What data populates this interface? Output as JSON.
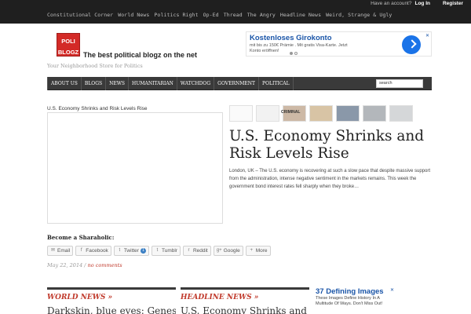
{
  "topbar": {
    "nav": [
      "Constitutional Corner",
      "World News",
      "Politics Right",
      "Op-Ed",
      "Thread",
      "The Angry",
      "Headline News",
      "Weird, Strange & Ugly"
    ],
    "account_prompt": "Have an account?",
    "login": "Log In",
    "register": "Register"
  },
  "header": {
    "logo_line1": "POLI",
    "logo_line2": "BLOGZ",
    "tagline": "The best political blogz on the net",
    "subtagline": "Your Neighborhood Store for Politics"
  },
  "ad_top": {
    "title": "Kostenloses Girokonto",
    "text": "mit bis zu 150€ Prämie . Mit gratis Visa-Karte. Jetzt Konto eröffnen!",
    "close": "✕"
  },
  "navbar": {
    "items": [
      "ABOUT US",
      "BLOGS",
      "NEWS",
      "HUMANITARIAN",
      "WATCHDOG",
      "GOVERNMENT",
      "POLITICAL"
    ],
    "search_value": "search"
  },
  "post": {
    "caption": "U.S. Economy Shrinks and Risk Levels Rise",
    "headline": "U.S. Economy Shrinks and Risk Levels Rise",
    "excerpt": "London, UK – The U.S. economy is recovering at such a slow pace that despite massive support from the administration, intense negative sentiment in the markets remains. This week the government bond interest rates fell sharply when they broke…",
    "thumb_label": "CRIMINAL",
    "date": "May 22, 2014",
    "separator": "/",
    "comments": "no comments"
  },
  "share": {
    "label": "Become a Sharaholic:",
    "buttons": [
      {
        "icon": "✉",
        "label": "Email"
      },
      {
        "icon": "f",
        "label": "Facebook"
      },
      {
        "icon": "t",
        "label": "Twitter"
      },
      {
        "icon": "t",
        "label": "Tumblr"
      },
      {
        "icon": "r",
        "label": "Reddit"
      },
      {
        "icon": "g+",
        "label": "Google"
      },
      {
        "icon": "+",
        "label": "More"
      }
    ],
    "twitter_badge": "1"
  },
  "sections": [
    {
      "title": "WORLD NEWS »",
      "teaser": "Darkskin, blue eyes: Genes point to…"
    },
    {
      "title": "HEADLINE NEWS »",
      "teaser": "U.S. Economy Shrinks and Risk…"
    }
  ],
  "ad_bottom": {
    "title": "37 Defining Images",
    "text": "These Images Define History In A Multitude Of Ways. Don't Miss Out!",
    "close": "✕"
  }
}
